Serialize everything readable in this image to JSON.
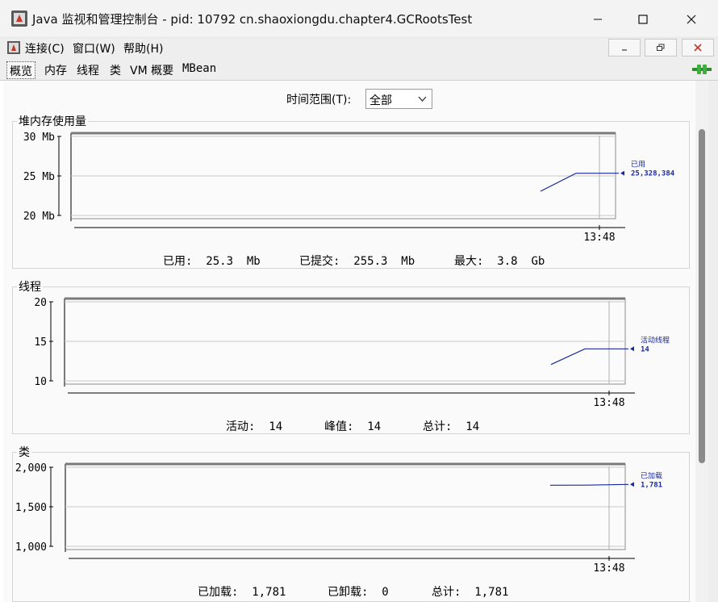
{
  "window": {
    "title": "Java 监视和管理控制台 - pid: 10792 cn.shaoxiongdu.chapter4.GCRootsTest"
  },
  "menu": {
    "items": [
      {
        "label": "连接(C)"
      },
      {
        "label": "窗口(W)"
      },
      {
        "label": "帮助(H)"
      }
    ]
  },
  "tabs": [
    {
      "label": "概览",
      "selected": true
    },
    {
      "label": "内存"
    },
    {
      "label": "线程"
    },
    {
      "label": "类"
    },
    {
      "label": "VM 概要"
    },
    {
      "label": "MBean"
    }
  ],
  "time_range": {
    "label": "时间范围(T):",
    "value": "全部"
  },
  "panels": {
    "heap": {
      "title": "堆内存使用量",
      "legend_name": "已用",
      "legend_value": "25,328,384",
      "time_label": "13:48",
      "stats": [
        {
          "label": "已用:",
          "value": "25.3  Mb"
        },
        {
          "label": "已提交:",
          "value": "255.3  Mb"
        },
        {
          "label": "最大:",
          "value": "3.8  Gb"
        }
      ]
    },
    "threads": {
      "title": "线程",
      "legend_name": "活动线程",
      "legend_value": "14",
      "time_label": "13:48",
      "stats": [
        {
          "label": "活动:",
          "value": "14"
        },
        {
          "label": "峰值:",
          "value": "14"
        },
        {
          "label": "总计:",
          "value": "14"
        }
      ]
    },
    "classes": {
      "title": "类",
      "legend_name": "已加载",
      "legend_value": "1,781",
      "time_label": "13:48",
      "stats": [
        {
          "label": "已加载:",
          "value": "1,781"
        },
        {
          "label": "已卸载:",
          "value": "0"
        },
        {
          "label": "总计:",
          "value": "1,781"
        }
      ]
    }
  },
  "colors": {
    "series": "#1a2a9c",
    "grid": "#c8c8c8",
    "frame": "#8c8c8c"
  },
  "chart_data": [
    {
      "type": "line",
      "title": "堆内存使用量",
      "ylabel": "Mb",
      "yticks": [
        "30 Mb",
        "25 Mb",
        "20 Mb"
      ],
      "ylim": [
        19.5,
        30
      ],
      "series": [
        {
          "name": "已用",
          "points": [
            [
              0,
              23
            ],
            [
              1,
              25.3
            ],
            [
              2,
              25.3
            ]
          ]
        }
      ],
      "xlabel_end": "13:48"
    },
    {
      "type": "line",
      "title": "线程",
      "yticks": [
        "20",
        "15",
        "10"
      ],
      "ylim": [
        9.5,
        20
      ],
      "series": [
        {
          "name": "活动线程",
          "points": [
            [
              0,
              12
            ],
            [
              1,
              14
            ],
            [
              2,
              14
            ]
          ]
        }
      ],
      "xlabel_end": "13:48"
    },
    {
      "type": "line",
      "title": "类",
      "yticks": [
        "2,000",
        "1,500",
        "1,000"
      ],
      "ylim": [
        950,
        2000
      ],
      "series": [
        {
          "name": "已加载",
          "points": [
            [
              0,
              1770
            ],
            [
              1,
              1771
            ],
            [
              2,
              1781
            ]
          ]
        }
      ],
      "xlabel_end": "13:48"
    }
  ]
}
